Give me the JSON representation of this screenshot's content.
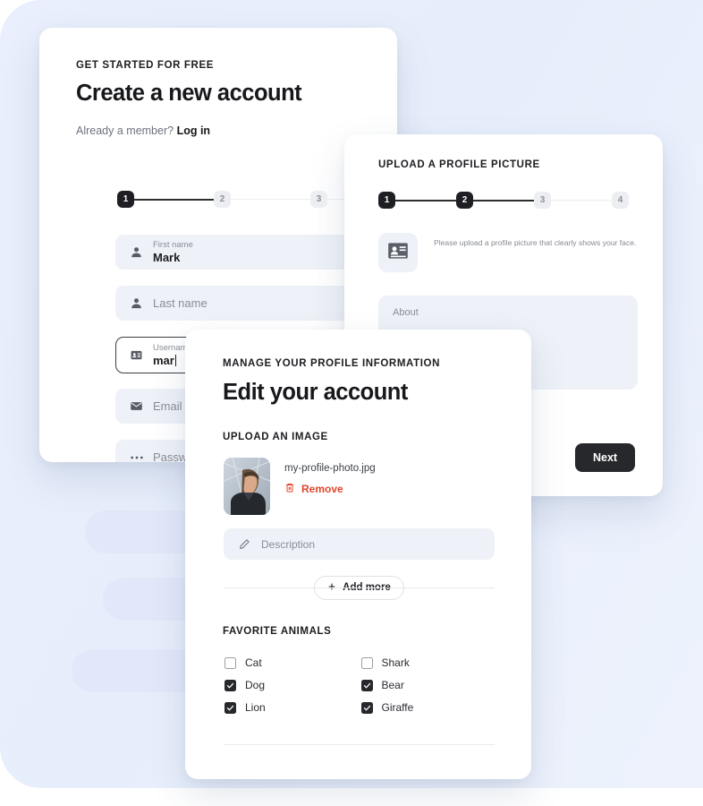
{
  "theme": {
    "background": "#e8eefb",
    "card_background": "#ffffff",
    "accent_dark": "#27282c",
    "field_background": "#eef1f7",
    "danger": "#e0462f",
    "muted_text": "#8a8d95"
  },
  "card_signup": {
    "eyebrow": "GET STARTED FOR FREE",
    "title": "Create a new account",
    "member_prompt": "Already a member?",
    "login_link": "Log in",
    "stepper": {
      "steps": [
        "1",
        "2",
        "3"
      ],
      "active_index": 0
    },
    "fields": [
      {
        "icon": "person-icon",
        "label": "First name",
        "value": "Mark",
        "placeholder": "",
        "focused": false
      },
      {
        "icon": "person-icon",
        "label": "",
        "value": "",
        "placeholder": "Last name",
        "focused": false
      },
      {
        "icon": "id-card-icon",
        "label": "Username",
        "value": "mar",
        "placeholder": "",
        "focused": true
      },
      {
        "icon": "envelope-icon",
        "label": "",
        "value": "",
        "placeholder": "Email",
        "focused": false
      },
      {
        "icon": "dots-icon",
        "label": "",
        "value": "",
        "placeholder": "Password",
        "focused": false
      }
    ]
  },
  "card_upload": {
    "eyebrow": "UPLOAD A PROFILE PICTURE",
    "stepper": {
      "steps": [
        "1",
        "2",
        "3",
        "4"
      ],
      "active_count": 2
    },
    "upload_icon": "id-card-icon",
    "helper_text": "Please upload a profile picture that clearly shows your face.",
    "about_placeholder": "About",
    "next_label": "Next"
  },
  "card_edit": {
    "eyebrow": "MANAGE YOUR PROFILE INFORMATION",
    "title": "Edit your account",
    "upload_section_label": "UPLOAD AN IMAGE",
    "file": {
      "thumbnail": "profile-photo-thumbnail",
      "name": "my-profile-photo.jpg",
      "remove_label": "Remove",
      "remove_icon": "trash-icon"
    },
    "description_field": {
      "icon": "pencil-icon",
      "placeholder": "Description"
    },
    "add_more_label": "Add more",
    "add_more_icon": "plus-icon",
    "animals_section_label": "FAVORITE ANIMALS",
    "animals": [
      {
        "label": "Cat",
        "checked": false
      },
      {
        "label": "Shark",
        "checked": false
      },
      {
        "label": "Dog",
        "checked": true
      },
      {
        "label": "Bear",
        "checked": true
      },
      {
        "label": "Lion",
        "checked": true
      },
      {
        "label": "Giraffe",
        "checked": true
      }
    ]
  }
}
